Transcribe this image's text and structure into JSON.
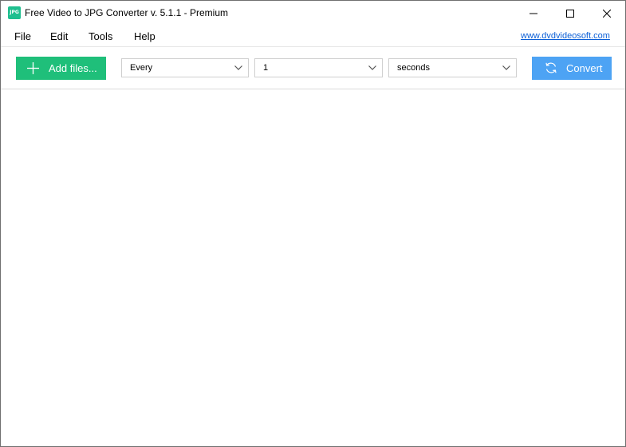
{
  "window": {
    "title": "Free Video to JPG Converter v. 5.1.1 - Premium",
    "icon_text": "JPG",
    "icon": "app-jpg-icon"
  },
  "menu": {
    "items": [
      "File",
      "Edit",
      "Tools",
      "Help"
    ],
    "website_link": "www.dvdvideosoft.com"
  },
  "toolbar": {
    "add_files_label": "Add files...",
    "interval_mode": "Every",
    "interval_value": "1",
    "interval_unit": "seconds",
    "convert_label": "Convert"
  },
  "colors": {
    "add_button": "#1fbf7a",
    "convert_button": "#4da3f4",
    "link": "#0b5fd7"
  }
}
